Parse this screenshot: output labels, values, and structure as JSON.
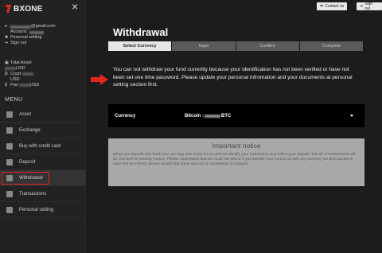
{
  "brand": {
    "name": "BXONE"
  },
  "account": {
    "email_suffix": "gmail.com",
    "account_label": "Account:",
    "personal_setting": "Personal setting",
    "sign_out": "Sign out"
  },
  "assets": {
    "total_label": "Total Asset",
    "total_unit": "USD",
    "crypto_label": "Crypt",
    "crypto_unit": "USD",
    "fiat_label": "Fiat",
    "fiat_unit": "USD"
  },
  "menu": {
    "title": "MENU",
    "items": [
      {
        "label": "Asset"
      },
      {
        "label": "Exchange"
      },
      {
        "label": "Buy with credit card"
      },
      {
        "label": "Deposit"
      },
      {
        "label": "Withdrawal",
        "active": true
      },
      {
        "label": "Transactions"
      },
      {
        "label": "Personal setting"
      }
    ]
  },
  "topbar": {
    "contact_label": "Contact us",
    "signout_label": "Sign out"
  },
  "page": {
    "title": "Withdrawal",
    "steps": [
      "Select Currency",
      "Input",
      "Confirm",
      "Complete"
    ],
    "message": "You can not withdraw your fund currently because your identification has not been verified or have not been set one time password. Please update your personal infromation and your documents at personal setting section first."
  },
  "currency": {
    "label": "Currency",
    "value_prefix": "Bitcoin : ",
    "value_suffix": "BTC"
  },
  "notice": {
    "title": "Important notice",
    "body": "When you deposit with bank wire, we may take a few hours until we identify your transaction and reflect your deposit. The all of transactions will be checked for security reason. Please understand that we could not refund if you transfer your fund to us with any currency we dont accept in case that we refund, please accept that some amount of commission is charged."
  },
  "colors": {
    "accent": "#e0271f",
    "background": "#1c1c1c",
    "sidebar": "#222222",
    "notice_bg": "#a9a9a9"
  }
}
